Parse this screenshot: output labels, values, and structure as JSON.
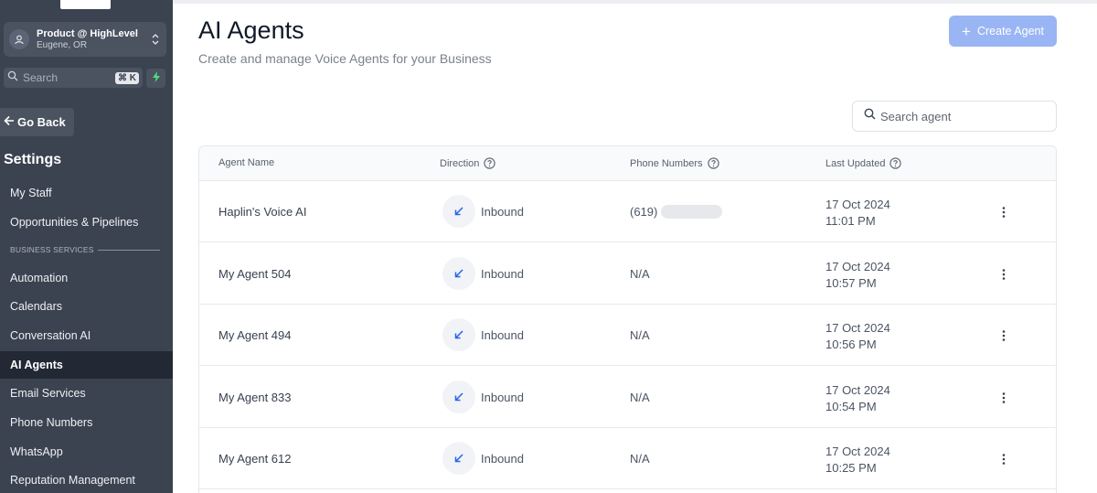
{
  "sidebar": {
    "location": {
      "name": "Product @ HighLevel",
      "sub": "Eugene, OR"
    },
    "search": {
      "placeholder": "Search",
      "shortcut": "⌘ K"
    },
    "go_back": "Go Back",
    "settings_title": "Settings",
    "items_top": [
      {
        "label": "My Staff"
      },
      {
        "label": "Opportunities & Pipelines"
      }
    ],
    "section_label": "BUSINESS SERVICES",
    "items": [
      {
        "label": "Automation"
      },
      {
        "label": "Calendars"
      },
      {
        "label": "Conversation AI"
      },
      {
        "label": "AI Agents",
        "active": true
      },
      {
        "label": "Email Services"
      },
      {
        "label": "Phone Numbers"
      },
      {
        "label": "WhatsApp"
      },
      {
        "label": "Reputation Management"
      }
    ]
  },
  "header": {
    "title": "AI Agents",
    "subtitle": "Create and manage Voice Agents for your Business",
    "create_label": "Create Agent"
  },
  "search_agent": {
    "placeholder": "Search agent"
  },
  "table": {
    "columns": [
      "Agent Name",
      "Direction",
      "Phone Numbers",
      "Last Updated"
    ],
    "rows": [
      {
        "name": "Haplin's Voice AI",
        "direction": "Inbound",
        "phone": "(619)",
        "phone_redacted": true,
        "date": "17 Oct 2024",
        "time": "11:01 PM"
      },
      {
        "name": "My Agent 504",
        "direction": "Inbound",
        "phone": "N/A",
        "phone_redacted": false,
        "date": "17 Oct 2024",
        "time": "10:57 PM"
      },
      {
        "name": "My Agent 494",
        "direction": "Inbound",
        "phone": "N/A",
        "phone_redacted": false,
        "date": "17 Oct 2024",
        "time": "10:56 PM"
      },
      {
        "name": "My Agent 833",
        "direction": "Inbound",
        "phone": "N/A",
        "phone_redacted": false,
        "date": "17 Oct 2024",
        "time": "10:54 PM"
      },
      {
        "name": "My Agent 612",
        "direction": "Inbound",
        "phone": "N/A",
        "phone_redacted": false,
        "date": "17 Oct 2024",
        "time": "10:25 PM"
      }
    ]
  },
  "colors": {
    "sidebar_bg": "#3b4250",
    "sidebar_active": "#222834",
    "primary_button": "#9ab5f4",
    "direction_icon": "#2563eb",
    "bolt": "#4ade80"
  },
  "icons": {
    "location": "building-icon",
    "switcher": "chevron-up-down-icon",
    "search": "search-icon",
    "bolt": "lightning-bolt-icon",
    "back": "arrow-left-icon",
    "create": "plus-icon",
    "help": "question-circle-icon",
    "direction": "arrow-down-left-icon",
    "actions": "more-vertical-icon"
  }
}
